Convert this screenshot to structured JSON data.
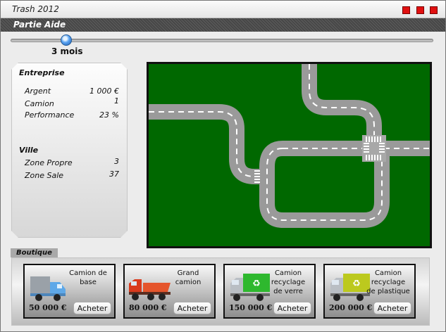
{
  "window": {
    "title": "Trash 2012",
    "controls": [
      "minimize-icon",
      "maximize-icon",
      "close-icon"
    ],
    "control_color": "#e01010"
  },
  "menu": {
    "items": [
      {
        "label": "Partie"
      },
      {
        "label": "Aide"
      }
    ]
  },
  "time_slider": {
    "label": "3 mois"
  },
  "stats": {
    "entreprise": {
      "title": "Entreprise",
      "rows": [
        {
          "label": "Argent",
          "value": "1 000 €"
        },
        {
          "label": "Camion",
          "value": "1"
        },
        {
          "label": "Performance",
          "value": "23 %"
        }
      ]
    },
    "ville": {
      "title": "Ville",
      "rows": [
        {
          "label": "Zone Propre",
          "value": "3"
        },
        {
          "label": "Zone Sale",
          "value": "37"
        }
      ]
    }
  },
  "map": {
    "grass_color": "#006800",
    "road_color": "#9a9a9a"
  },
  "shop": {
    "title": "Boutique",
    "items": [
      {
        "name": "Camion de base",
        "price": "50 000 €",
        "button": "Acheter",
        "icon": "basic-truck-icon"
      },
      {
        "name": "Grand camion",
        "price": "80 000 €",
        "button": "Acheter",
        "icon": "large-truck-icon"
      },
      {
        "name": "Camion recyclage de verre",
        "price": "150 000 €",
        "button": "Acheter",
        "icon": "glass-recycling-truck-icon"
      },
      {
        "name": "Camion recyclage de plastique",
        "price": "200 000 €",
        "button": "Acheter",
        "icon": "plastic-recycling-truck-icon"
      }
    ]
  }
}
